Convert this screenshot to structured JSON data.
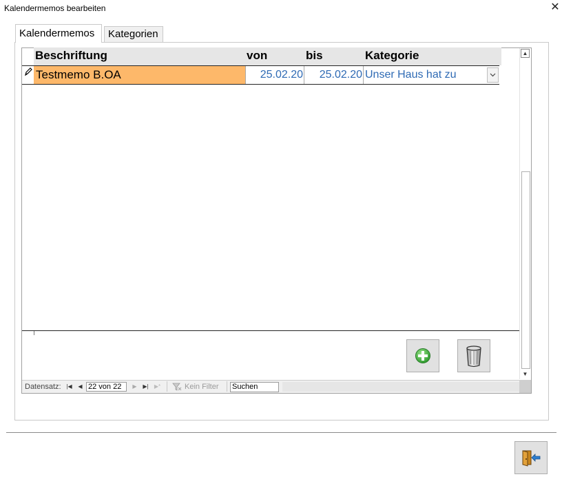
{
  "window": {
    "title": "Kalendermemos bearbeiten",
    "close_glyph": "✕"
  },
  "tabs": [
    {
      "label": "Kalendermemos",
      "active": true
    },
    {
      "label": "Kategorien",
      "active": false
    }
  ],
  "table": {
    "columns": [
      "Beschriftung",
      "von",
      "bis",
      "Kategorie"
    ],
    "rows": [
      {
        "beschriftung": "Testmemo B.OA",
        "von": "25.02.20",
        "bis": "25.02.20",
        "kategorie": "Unser Haus hat zu"
      }
    ],
    "highlight_color": "#fdb86a",
    "value_color": "#2e6ab4"
  },
  "buttons": {
    "add": "add-icon",
    "delete": "trash-icon",
    "exit": "exit-door-icon"
  },
  "navigation": {
    "label": "Datensatz:",
    "record": "22 von 22",
    "filter": "Kein Filter",
    "search": "Suchen"
  }
}
